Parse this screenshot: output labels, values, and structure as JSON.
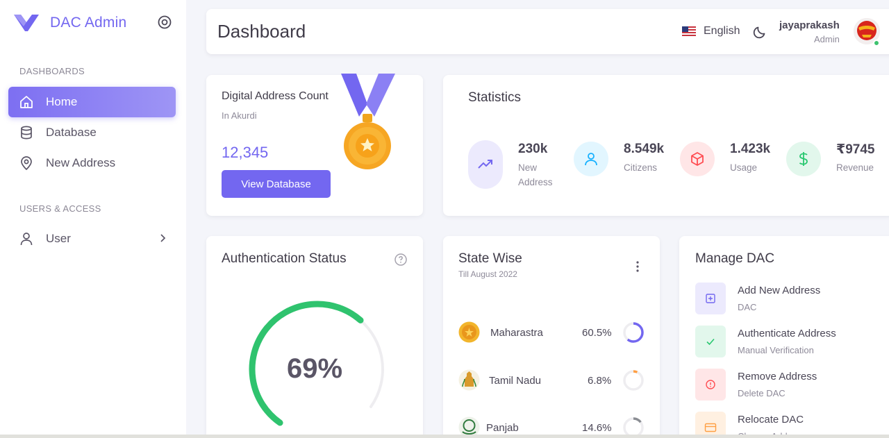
{
  "sidebar": {
    "brand": "DAC Admin",
    "sections": [
      {
        "label": "DASHBOARDS"
      },
      {
        "label": "USERS & ACCESS"
      }
    ],
    "items": [
      {
        "label": "Home",
        "icon": "home-icon",
        "active": true
      },
      {
        "label": "Database",
        "icon": "database-icon"
      },
      {
        "label": "New Address",
        "icon": "map-pin-icon"
      },
      {
        "label": "User",
        "icon": "user-icon"
      }
    ]
  },
  "header": {
    "title": "Dashboard",
    "language": "English",
    "user_name": "jayaprakash",
    "user_role": "Admin"
  },
  "dac_card": {
    "title": "Digital Address Count",
    "subtitle": "In Akurdi",
    "value": "12,345",
    "button": "View Database"
  },
  "statistics": {
    "title": "Statistics",
    "items": [
      {
        "value": "230k",
        "label": "New\nAddress",
        "icon": "trending-up-icon",
        "color": "#7367f0",
        "bg": "#eceafd"
      },
      {
        "value": "8.549k",
        "label": "Citizens",
        "icon": "user-icon",
        "color": "#16b1ff",
        "bg": "#e2f6ff"
      },
      {
        "value": "1.423k",
        "label": "Usage",
        "icon": "cube-icon",
        "color": "#ff4c51",
        "bg": "#ffe6e7"
      },
      {
        "value": "₹9745",
        "label": "Revenue",
        "icon": "dollar-icon",
        "color": "#28c76f",
        "bg": "#e2f7ec"
      }
    ]
  },
  "auth": {
    "title": "Authentication Status",
    "percent": 69,
    "percent_label": "69%",
    "color": "#2fc36e"
  },
  "state_wise": {
    "title": "State Wise",
    "subtitle": "Till August 2022",
    "rows": [
      {
        "name": "Maharastra",
        "pct_label": "60.5%",
        "pct": 60.5,
        "color": "#7367f0"
      },
      {
        "name": "Tamil Nadu",
        "pct_label": "6.8%",
        "pct": 6.8,
        "color": "#ff9f43"
      },
      {
        "name": "Panjab",
        "pct_label": "14.6%",
        "pct": 14.6,
        "color": "#8a8d93"
      }
    ]
  },
  "manage": {
    "title": "Manage DAC",
    "items": [
      {
        "name": "Add New Address",
        "sub": "DAC",
        "icon": "plus-square-icon",
        "color": "#7367f0",
        "bg": "#eceafd"
      },
      {
        "name": "Authenticate Address",
        "sub": "Manual Verification",
        "icon": "check-icon",
        "color": "#28c76f",
        "bg": "#e2f7ec"
      },
      {
        "name": "Remove Address",
        "sub": "Delete DAC",
        "icon": "alert-circle-icon",
        "color": "#ff4c51",
        "bg": "#ffe6e7"
      },
      {
        "name": "Relocate DAC",
        "sub": "Change Address",
        "icon": "credit-card-icon",
        "color": "#ff9f43",
        "bg": "#fff0e1"
      }
    ]
  }
}
